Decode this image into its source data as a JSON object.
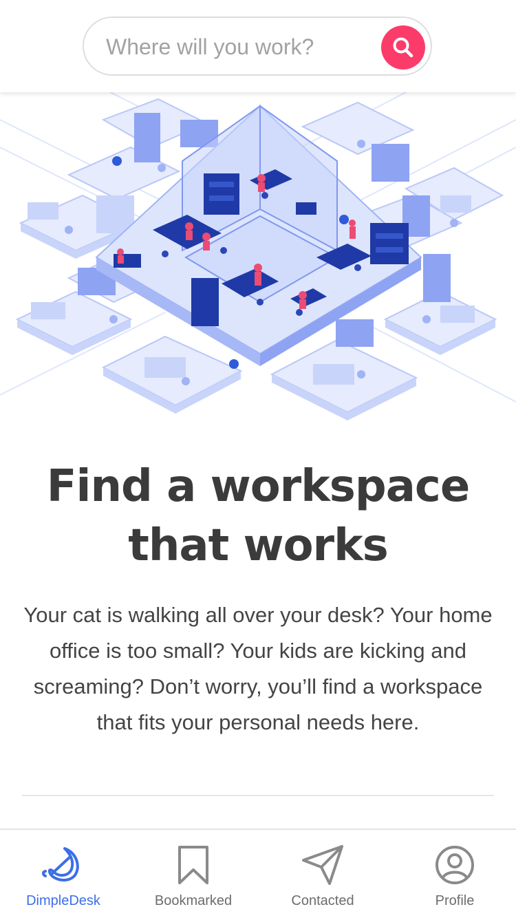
{
  "search": {
    "placeholder": "Where will you work?",
    "value": "",
    "button_icon": "search-icon",
    "button_color": "#fb3c6b"
  },
  "hero": {
    "image": "isometric-office-illustration",
    "colors": {
      "light": "#e6ebfd",
      "mid": "#a7b8f6",
      "dark": "#1f3aa6",
      "accent": "#ec4b73"
    }
  },
  "main": {
    "title_line1": "Find a workspace",
    "title_line2": "that works",
    "description": "Your cat is walking all over your desk? Your home office is too small? Your kids are kicking and screaming? Don’t worry, you’ll find a workspace that fits your personal needs here."
  },
  "tabbar": {
    "active_color": "#3c6fe6",
    "inactive_color": "#6c6c6c",
    "items": [
      {
        "label": "DimpleDesk",
        "icon": "dimpledesk-logo-icon",
        "active": true
      },
      {
        "label": "Bookmarked",
        "icon": "bookmark-icon",
        "active": false
      },
      {
        "label": "Contacted",
        "icon": "send-icon",
        "active": false
      },
      {
        "label": "Profile",
        "icon": "profile-icon",
        "active": false
      }
    ]
  }
}
